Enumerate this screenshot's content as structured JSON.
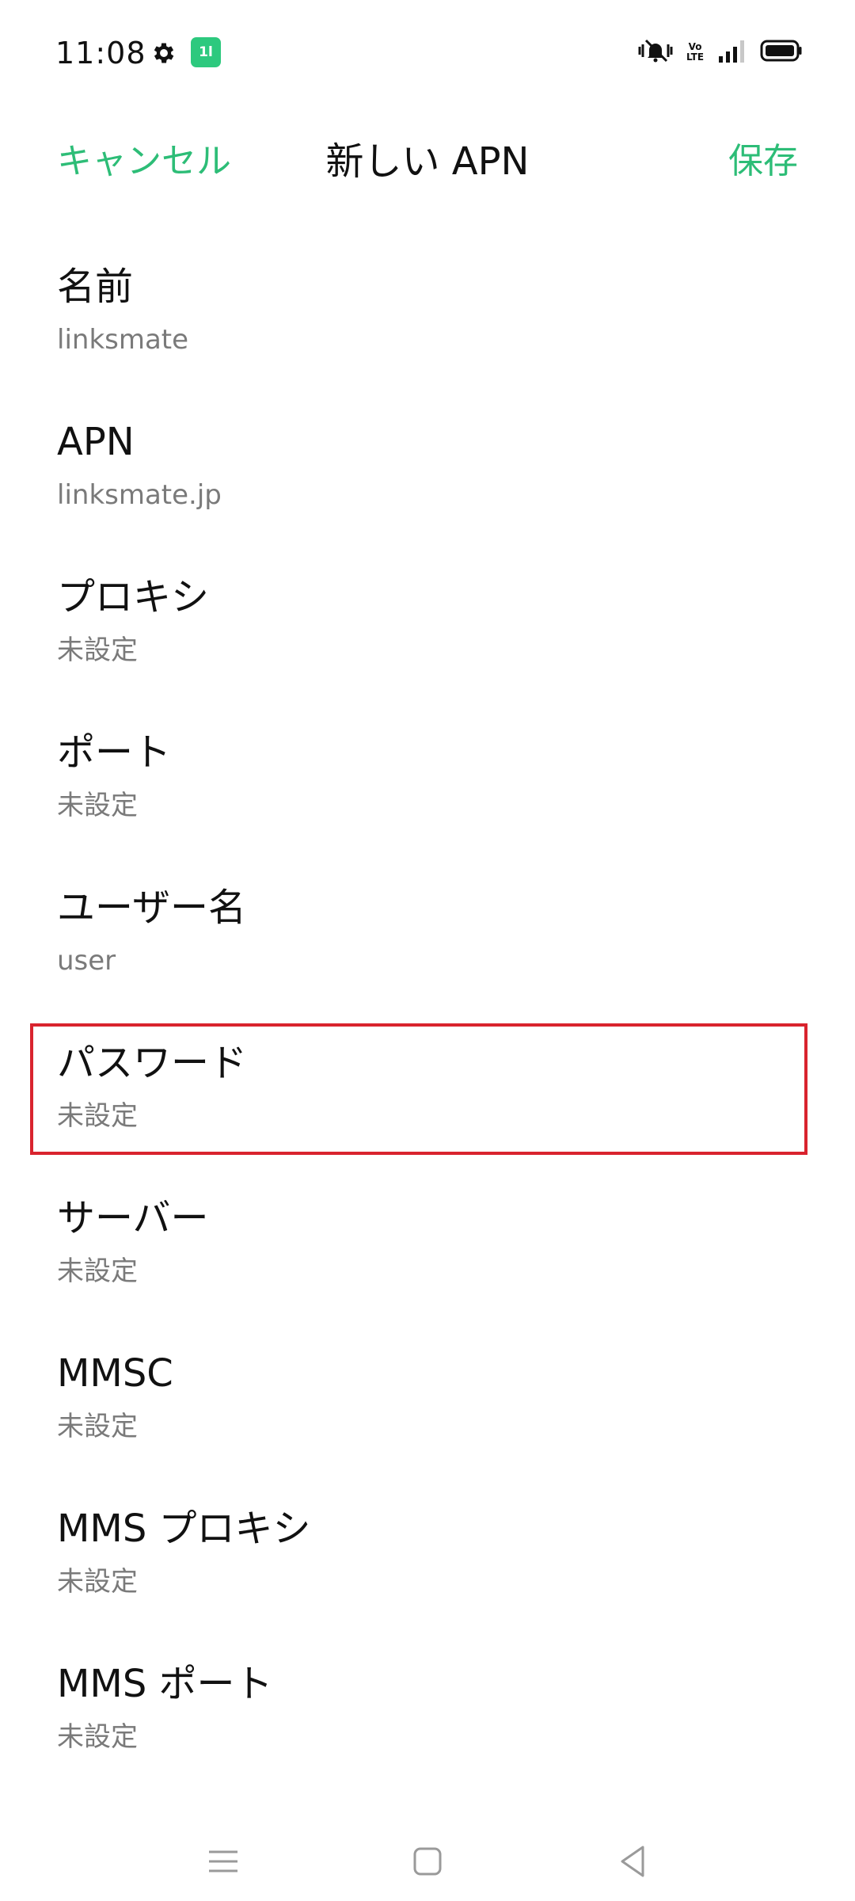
{
  "status_bar": {
    "time": "11:08",
    "icons": [
      "gear-icon",
      "app-notification-icon",
      "vibrate-mute-icon",
      "volte-icon",
      "signal-icon",
      "battery-icon"
    ],
    "app_badge": "1l",
    "volte_top": "Vo",
    "volte_bottom": "LTE",
    "accent_color": "#2dc97e"
  },
  "header": {
    "cancel_label": "キャンセル",
    "title": "新しい APN",
    "save_label": "保存",
    "accent_color": "#2dbd77"
  },
  "fields": [
    {
      "label": "名前",
      "value": "linksmate"
    },
    {
      "label": "APN",
      "value": "linksmate.jp"
    },
    {
      "label": "プロキシ",
      "value": "未設定"
    },
    {
      "label": "ポート",
      "value": "未設定"
    },
    {
      "label": "ユーザー名",
      "value": "user"
    },
    {
      "label": "パスワード",
      "value": "未設定",
      "highlighted": true
    },
    {
      "label": "サーバー",
      "value": "未設定"
    },
    {
      "label": "MMSC",
      "value": "未設定"
    },
    {
      "label": "MMS プロキシ",
      "value": "未設定"
    },
    {
      "label": "MMS ポート",
      "value": "未設定"
    }
  ],
  "highlight_color": "#d9232e",
  "nav_bar": {
    "icons": [
      "menu-icon",
      "home-icon",
      "back-icon"
    ]
  }
}
